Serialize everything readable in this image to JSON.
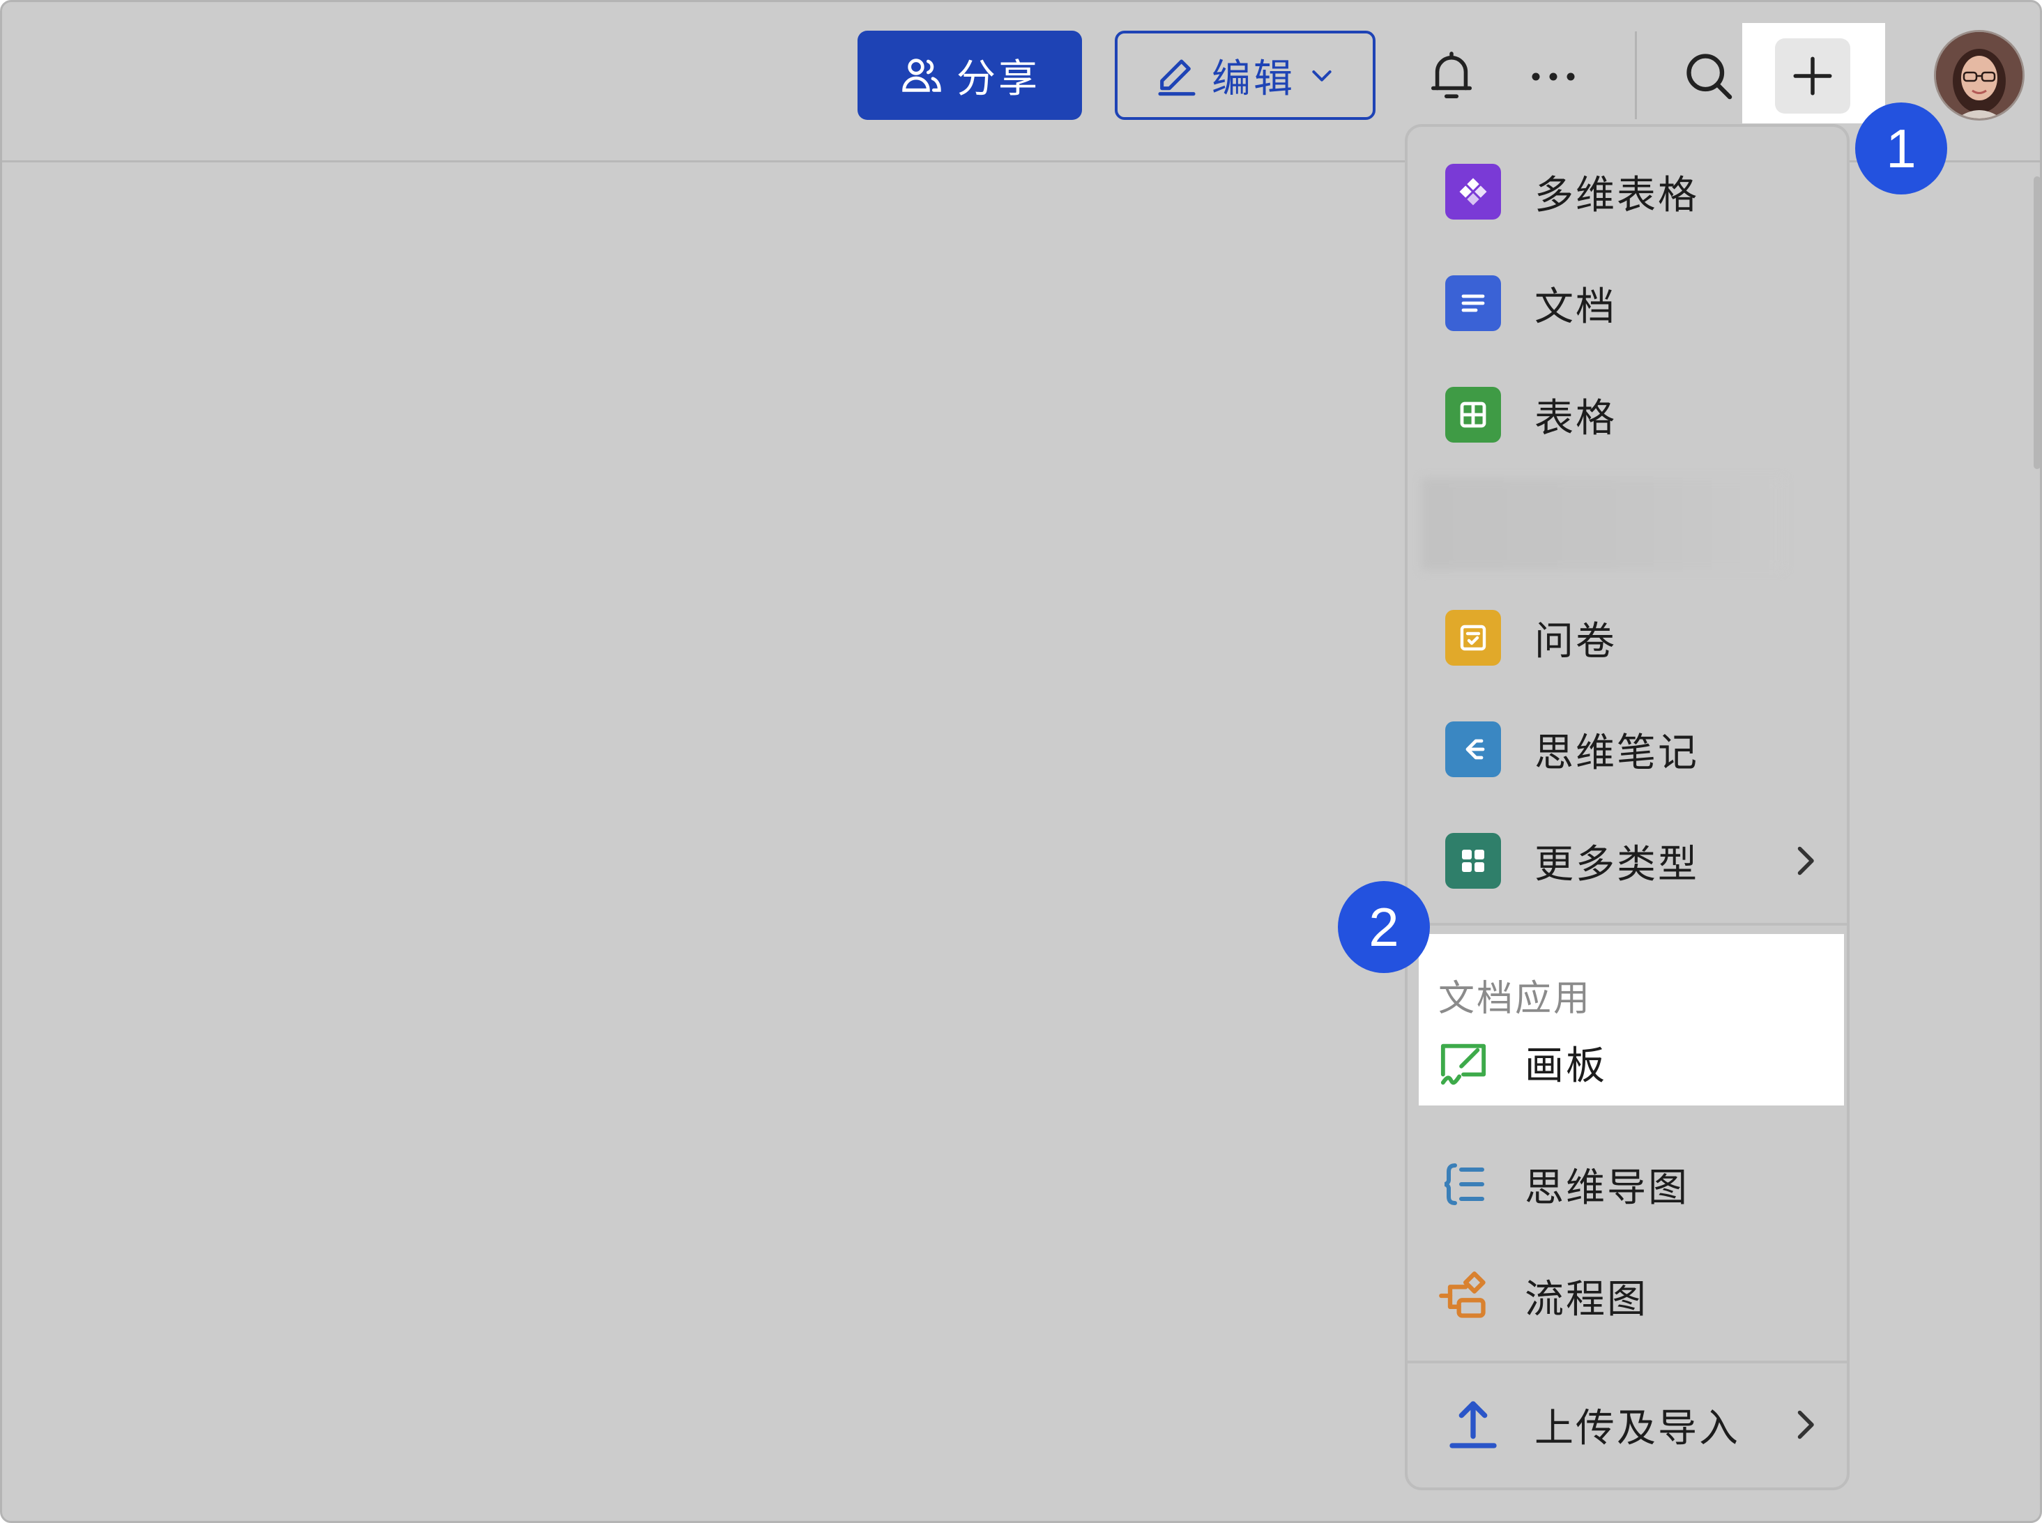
{
  "header": {
    "share_label": "分享",
    "edit_label": "编辑",
    "icons": [
      "share-users-icon",
      "pencil-icon",
      "chevron-down-icon",
      "bell-icon",
      "more-icon",
      "search-icon",
      "plus-icon",
      "avatar"
    ]
  },
  "annotations": {
    "badge_1": "1",
    "badge_2": "2"
  },
  "menu": {
    "items": [
      {
        "label": "多维表格",
        "icon": "base-icon",
        "color": "#7a3ad6"
      },
      {
        "label": "文档",
        "icon": "doc-icon",
        "color": "#3a62d6"
      },
      {
        "label": "表格",
        "icon": "sheet-icon",
        "color": "#3f9b45"
      },
      {
        "label": "问卷",
        "icon": "survey-icon",
        "color": "#e1a92a"
      },
      {
        "label": "思维笔记",
        "icon": "mindnote-icon",
        "color": "#3a87c2"
      },
      {
        "label": "更多类型",
        "icon": "grid-icon",
        "color": "#2f7f6a"
      }
    ],
    "doc_apps_title": "文档应用",
    "apps": [
      {
        "label": "画板",
        "icon": "whiteboard-icon",
        "color": "#3daa4a"
      },
      {
        "label": "思维导图",
        "icon": "mindmap-icon",
        "color": "#3a7fb8"
      },
      {
        "label": "流程图",
        "icon": "flowchart-icon",
        "color": "#d9812f"
      }
    ],
    "upload_label": "上传及导入",
    "upload_icon": "upload-icon"
  },
  "colors": {
    "accent": "#1e43b5",
    "badge": "#2352df",
    "background": "#cccccc"
  }
}
